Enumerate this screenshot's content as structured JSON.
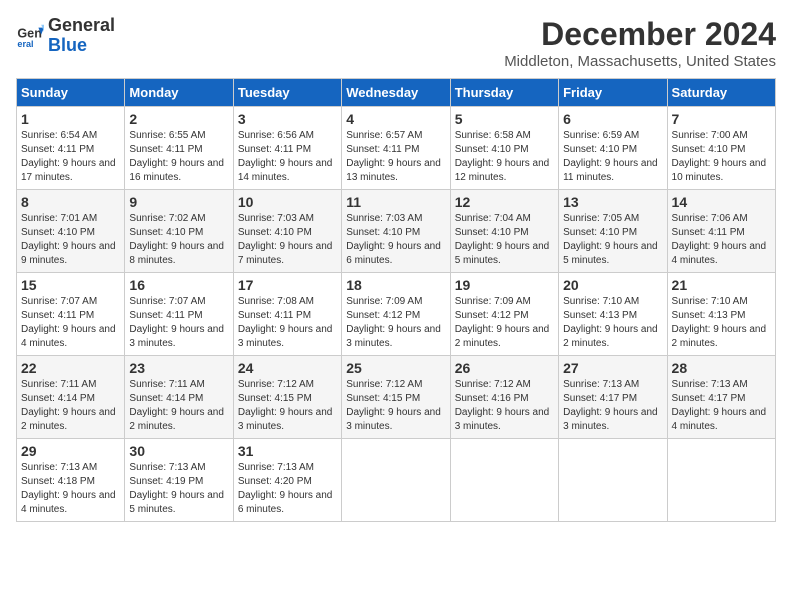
{
  "logo": {
    "line1": "General",
    "line2": "Blue"
  },
  "title": "December 2024",
  "subtitle": "Middleton, Massachusetts, United States",
  "headers": [
    "Sunday",
    "Monday",
    "Tuesday",
    "Wednesday",
    "Thursday",
    "Friday",
    "Saturday"
  ],
  "weeks": [
    [
      {
        "day": "1",
        "info": "Sunrise: 6:54 AM\nSunset: 4:11 PM\nDaylight: 9 hours and 17 minutes."
      },
      {
        "day": "2",
        "info": "Sunrise: 6:55 AM\nSunset: 4:11 PM\nDaylight: 9 hours and 16 minutes."
      },
      {
        "day": "3",
        "info": "Sunrise: 6:56 AM\nSunset: 4:11 PM\nDaylight: 9 hours and 14 minutes."
      },
      {
        "day": "4",
        "info": "Sunrise: 6:57 AM\nSunset: 4:11 PM\nDaylight: 9 hours and 13 minutes."
      },
      {
        "day": "5",
        "info": "Sunrise: 6:58 AM\nSunset: 4:10 PM\nDaylight: 9 hours and 12 minutes."
      },
      {
        "day": "6",
        "info": "Sunrise: 6:59 AM\nSunset: 4:10 PM\nDaylight: 9 hours and 11 minutes."
      },
      {
        "day": "7",
        "info": "Sunrise: 7:00 AM\nSunset: 4:10 PM\nDaylight: 9 hours and 10 minutes."
      }
    ],
    [
      {
        "day": "8",
        "info": "Sunrise: 7:01 AM\nSunset: 4:10 PM\nDaylight: 9 hours and 9 minutes."
      },
      {
        "day": "9",
        "info": "Sunrise: 7:02 AM\nSunset: 4:10 PM\nDaylight: 9 hours and 8 minutes."
      },
      {
        "day": "10",
        "info": "Sunrise: 7:03 AM\nSunset: 4:10 PM\nDaylight: 9 hours and 7 minutes."
      },
      {
        "day": "11",
        "info": "Sunrise: 7:03 AM\nSunset: 4:10 PM\nDaylight: 9 hours and 6 minutes."
      },
      {
        "day": "12",
        "info": "Sunrise: 7:04 AM\nSunset: 4:10 PM\nDaylight: 9 hours and 5 minutes."
      },
      {
        "day": "13",
        "info": "Sunrise: 7:05 AM\nSunset: 4:10 PM\nDaylight: 9 hours and 5 minutes."
      },
      {
        "day": "14",
        "info": "Sunrise: 7:06 AM\nSunset: 4:11 PM\nDaylight: 9 hours and 4 minutes."
      }
    ],
    [
      {
        "day": "15",
        "info": "Sunrise: 7:07 AM\nSunset: 4:11 PM\nDaylight: 9 hours and 4 minutes."
      },
      {
        "day": "16",
        "info": "Sunrise: 7:07 AM\nSunset: 4:11 PM\nDaylight: 9 hours and 3 minutes."
      },
      {
        "day": "17",
        "info": "Sunrise: 7:08 AM\nSunset: 4:11 PM\nDaylight: 9 hours and 3 minutes."
      },
      {
        "day": "18",
        "info": "Sunrise: 7:09 AM\nSunset: 4:12 PM\nDaylight: 9 hours and 3 minutes."
      },
      {
        "day": "19",
        "info": "Sunrise: 7:09 AM\nSunset: 4:12 PM\nDaylight: 9 hours and 2 minutes."
      },
      {
        "day": "20",
        "info": "Sunrise: 7:10 AM\nSunset: 4:13 PM\nDaylight: 9 hours and 2 minutes."
      },
      {
        "day": "21",
        "info": "Sunrise: 7:10 AM\nSunset: 4:13 PM\nDaylight: 9 hours and 2 minutes."
      }
    ],
    [
      {
        "day": "22",
        "info": "Sunrise: 7:11 AM\nSunset: 4:14 PM\nDaylight: 9 hours and 2 minutes."
      },
      {
        "day": "23",
        "info": "Sunrise: 7:11 AM\nSunset: 4:14 PM\nDaylight: 9 hours and 2 minutes."
      },
      {
        "day": "24",
        "info": "Sunrise: 7:12 AM\nSunset: 4:15 PM\nDaylight: 9 hours and 3 minutes."
      },
      {
        "day": "25",
        "info": "Sunrise: 7:12 AM\nSunset: 4:15 PM\nDaylight: 9 hours and 3 minutes."
      },
      {
        "day": "26",
        "info": "Sunrise: 7:12 AM\nSunset: 4:16 PM\nDaylight: 9 hours and 3 minutes."
      },
      {
        "day": "27",
        "info": "Sunrise: 7:13 AM\nSunset: 4:17 PM\nDaylight: 9 hours and 3 minutes."
      },
      {
        "day": "28",
        "info": "Sunrise: 7:13 AM\nSunset: 4:17 PM\nDaylight: 9 hours and 4 minutes."
      }
    ],
    [
      {
        "day": "29",
        "info": "Sunrise: 7:13 AM\nSunset: 4:18 PM\nDaylight: 9 hours and 4 minutes."
      },
      {
        "day": "30",
        "info": "Sunrise: 7:13 AM\nSunset: 4:19 PM\nDaylight: 9 hours and 5 minutes."
      },
      {
        "day": "31",
        "info": "Sunrise: 7:13 AM\nSunset: 4:20 PM\nDaylight: 9 hours and 6 minutes."
      },
      null,
      null,
      null,
      null
    ]
  ]
}
